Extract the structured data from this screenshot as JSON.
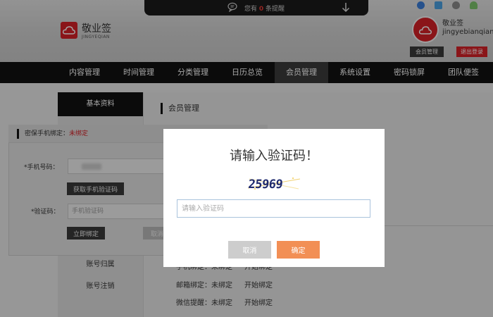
{
  "header": {
    "notice_prefix": "您有",
    "notice_count": "0",
    "notice_suffix": "条提醒",
    "brand_name": "敬业签",
    "brand_sub": "JINGYEQIAN",
    "user_name": "敬业签",
    "user_id": "jingyebianqian",
    "member_button": "会员管理",
    "logout_button": "退出登录",
    "top_icons": [
      "ie-icon",
      "windows-icon",
      "apple-icon",
      "android-icon"
    ]
  },
  "nav": {
    "items": [
      "内容管理",
      "时间管理",
      "分类管理",
      "日历总览",
      "会员管理",
      "系统设置",
      "密码锁屏",
      "团队便签"
    ],
    "active": "会员管理"
  },
  "sidebar": {
    "header": "基本资料",
    "items": [
      "账号归属",
      "账号注销"
    ]
  },
  "main": {
    "title": "会员管理",
    "bind_rows": [
      {
        "label": "手机绑定：",
        "status": "未绑定",
        "action": "开始绑定"
      },
      {
        "label": "邮箱绑定：",
        "status": "未绑定",
        "action": "开始绑定"
      },
      {
        "label": "微信提醒：",
        "status": "未绑定",
        "action": "开始绑定"
      }
    ]
  },
  "bind_dialog": {
    "title_label": "密保手机绑定：",
    "title_status": "未绑定",
    "phone_label": "*手机号码：",
    "get_code_button": "获取手机验证码",
    "code_label": "*验证码：",
    "code_placeholder": "手机验证码",
    "bind_button": "立即绑定",
    "cancel_button": "取消"
  },
  "captcha_modal": {
    "title": "请输入验证码！",
    "captcha_text": "25969",
    "input_placeholder": "请输入验证码",
    "cancel_button": "取消",
    "ok_button": "确定"
  },
  "colors": {
    "brand_red": "#d42127",
    "confirm_orange": "#f28f55",
    "cancel_grey": "#cdcdcd",
    "nav_black": "#111111"
  }
}
